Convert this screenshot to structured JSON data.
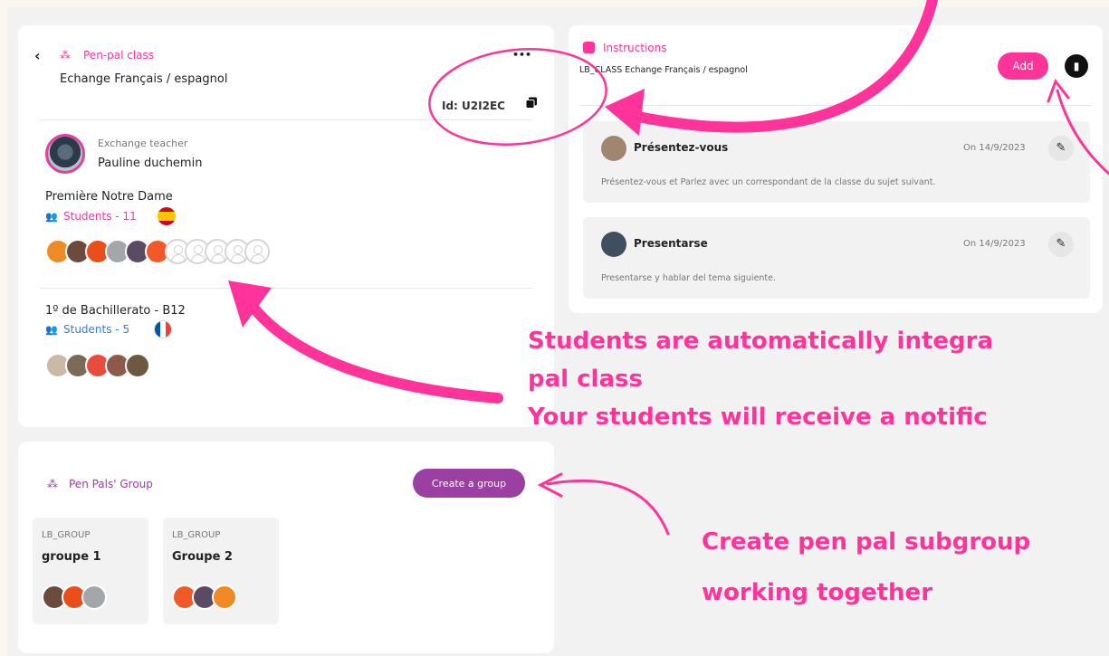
{
  "left_card": {
    "section_title": "Pen-pal class",
    "class_name": "Echange Français / espagnol",
    "more_label": "•••",
    "id_label": "Id: U2I2EC",
    "teacher_role": "Exchange teacher",
    "teacher_name": "Pauline duchemin",
    "school1": {
      "name": "Première Notre Dame",
      "students_label": "Students - 11",
      "flag": "spain-flag"
    },
    "school2": {
      "name": "1º de Bachillerato - B12",
      "students_label": "Students - 5",
      "flag": "france-flag"
    }
  },
  "instructions": {
    "title": "Instructions",
    "class_line": "LB_CLASS Echange Français / espagnol",
    "add_label": "Add",
    "items": [
      {
        "title": "Présentez-vous",
        "date": "On 14/9/2023",
        "body": "Présentez-vous et Parlez avec un correspondant de la classe du sujet suivant."
      },
      {
        "title": "Presentarse",
        "date": "On 14/9/2023",
        "body": "Presentarse y hablar del tema siguiente."
      }
    ]
  },
  "groups_card": {
    "title": "Pen Pals' Group",
    "create_label": "Create a group",
    "groups": [
      {
        "tag": "LB_GROUP",
        "name": "groupe 1"
      },
      {
        "tag": "LB_GROUP",
        "name": "Groupe 2"
      }
    ]
  },
  "annotations": {
    "line1": "Students are automatically integra",
    "line2": "pal class",
    "line3": "Your students will receive a notific",
    "line4": "Create pen pal subgroup",
    "line5": "working together"
  },
  "colors": {
    "accent_pink": "#ff3399",
    "purple": "#9b3fa3",
    "blue": "#2f80ed"
  }
}
